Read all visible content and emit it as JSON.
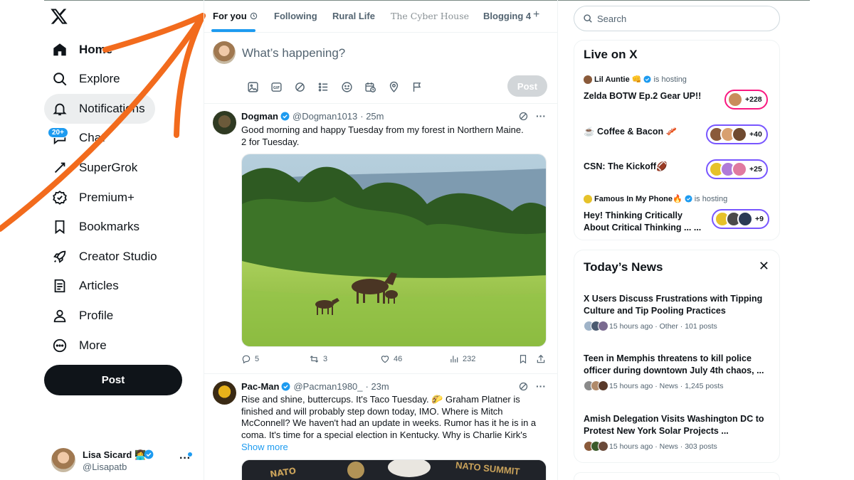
{
  "nav": {
    "items": [
      {
        "label": "Home",
        "icon": "home-icon"
      },
      {
        "label": "Explore",
        "icon": "search-icon"
      },
      {
        "label": "Notifications",
        "icon": "bell-icon"
      },
      {
        "label": "Chat",
        "icon": "chat-icon"
      },
      {
        "label": "SuperGrok",
        "icon": "grok-icon"
      },
      {
        "label": "Premium+",
        "icon": "premium-icon"
      },
      {
        "label": "Bookmarks",
        "icon": "bookmark-icon"
      },
      {
        "label": "Creator Studio",
        "icon": "rocket-icon"
      },
      {
        "label": "Articles",
        "icon": "articles-icon"
      },
      {
        "label": "Profile",
        "icon": "profile-icon"
      },
      {
        "label": "More",
        "icon": "more-icon"
      }
    ],
    "chat_badge": "20+",
    "post_label": "Post"
  },
  "account": {
    "name": "Lisa Sicard 👩‍💻",
    "handle": "@Lisapatb"
  },
  "tabs": [
    "For you",
    "Following",
    "Rural Life",
    "The Cyber House",
    "Blogging 4"
  ],
  "composer": {
    "placeholder": "What’s happening?",
    "post_label": "Post"
  },
  "tweets": [
    {
      "name": "Dogman",
      "handle": "@Dogman1013",
      "time": "· 25m",
      "text_line1": "Good morning and happy Tuesday from my forest in Northern Maine.",
      "text_line2": "2 for Tuesday.",
      "replies": "5",
      "reposts": "3",
      "likes": "46",
      "views": "232"
    },
    {
      "name": "Pac-Man",
      "handle": "@Pacman1980_",
      "time": "· 23m",
      "text": "Rise and shine, buttercups. It's Taco Tuesday. 🌮 Graham Platner is finished and will probably step down today, IMO. Where is Mitch McConnell? We haven't had an update in weeks. Rumor has it he is in a coma. It's time for a special election in Kentucky. Why is Charlie Kirk's",
      "show_more": "Show more",
      "media_caption": "NATO SUMMIT"
    }
  ],
  "search": {
    "placeholder": "Search"
  },
  "live": {
    "title": "Live on X",
    "items": [
      {
        "host": "Lil Auntie 👊",
        "hosting": "is hosting",
        "title": "Zelda BOTW Ep.2 Gear UP!!",
        "count": "+228"
      },
      {
        "host": "",
        "hosting": "",
        "title": "☕ Coffee & Bacon 🥓",
        "count": "+40"
      },
      {
        "host": "",
        "hosting": "",
        "title": "CSN: The Kickoff🏈",
        "count": "+25"
      },
      {
        "host": "Famous In My Phone🔥",
        "hosting": "is hosting",
        "title": "Hey! Thinking Critically About Critical Thinking ... ...",
        "count": "+9"
      }
    ]
  },
  "news": {
    "title": "Today’s News",
    "items": [
      {
        "title": "X Users Discuss Frustrations with Tipping Culture and Tip Pooling Practices",
        "meta": "15 hours ago · Other · 101 posts"
      },
      {
        "title": "Teen in Memphis threatens to kill police officer during downtown July 4th chaos, ...",
        "meta": "15 hours ago · News · 1,245 posts"
      },
      {
        "title": "Amish Delegation Visits Washington DC to Protest New York Solar Projects ...",
        "meta": "15 hours ago · News · 303 posts"
      }
    ]
  },
  "colors": {
    "accent": "#1d9bf0",
    "annotation": "#f26b1d",
    "live_pill": "#7856ff",
    "live_pill_highlight": "#f91880"
  }
}
